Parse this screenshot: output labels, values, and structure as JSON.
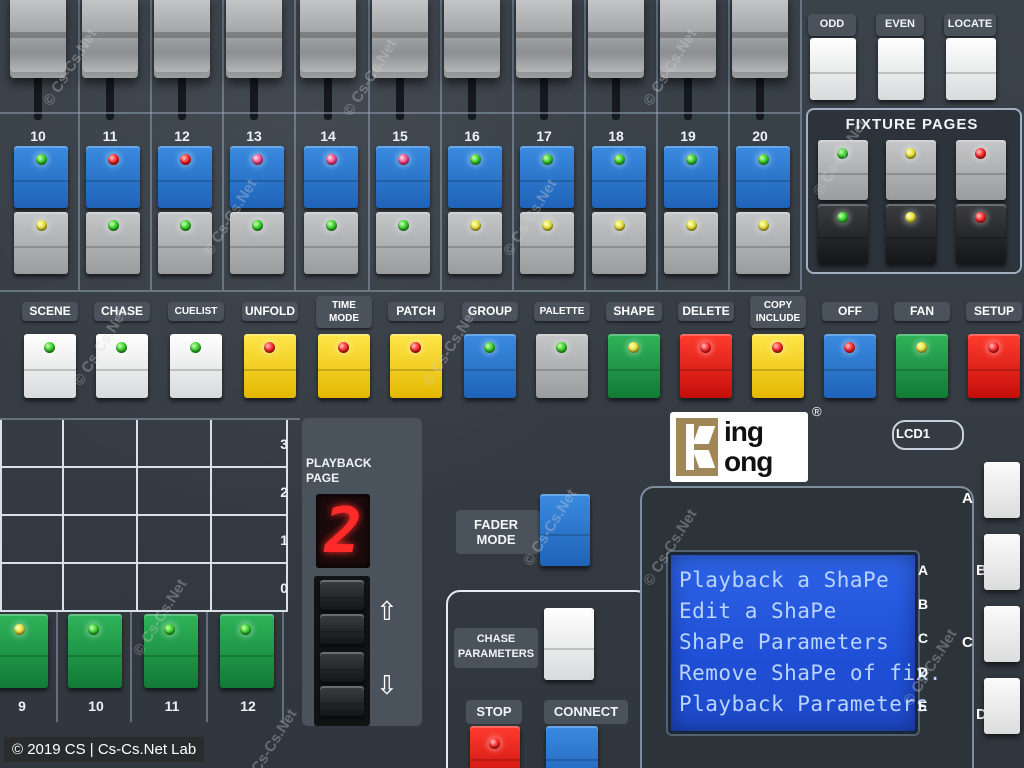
{
  "faders": {
    "numbers": [
      "10",
      "11",
      "12",
      "13",
      "14",
      "15",
      "16",
      "17",
      "18",
      "19",
      "20"
    ],
    "top_leds": [
      "green",
      "red",
      "red",
      "pink",
      "pink",
      "pink",
      "green",
      "green",
      "green",
      "green",
      "green"
    ],
    "bottom_leds": [
      "yellow",
      "green",
      "green",
      "green",
      "green",
      "green",
      "yellow",
      "yellow",
      "yellow",
      "yellow",
      "yellow"
    ]
  },
  "top_right": {
    "buttons": [
      "ODD",
      "EVEN",
      "LOCATE"
    ]
  },
  "fixture_pages": {
    "title": "FIXTURE PAGES",
    "top_leds": [
      "green",
      "yellow",
      "red"
    ],
    "bottom_leds": [
      "green",
      "yellow",
      "red"
    ]
  },
  "function_row": [
    {
      "label": "SCENE",
      "color": "white",
      "led": "green"
    },
    {
      "label": "CHASE",
      "color": "white",
      "led": "green"
    },
    {
      "label": "CUELIST",
      "color": "white",
      "led": "green"
    },
    {
      "label": "UNFOLD",
      "color": "yellow",
      "led": "red"
    },
    {
      "label": "TIME\nMODE",
      "color": "yellow",
      "led": "red"
    },
    {
      "label": "PATCH",
      "color": "yellow",
      "led": "red"
    },
    {
      "label": "GROUP",
      "color": "blue",
      "led": "green"
    },
    {
      "label": "PALETTE",
      "color": "grey",
      "led": "green"
    },
    {
      "label": "SHAPE",
      "color": "green",
      "led": "yellow"
    },
    {
      "label": "DELETE",
      "color": "red",
      "led": "red"
    },
    {
      "label": "COPY\nINCLUDE",
      "color": "yellow",
      "led": "red"
    },
    {
      "label": "OFF",
      "color": "blue",
      "led": "red"
    },
    {
      "label": "FAN",
      "color": "green",
      "led": "yellow"
    },
    {
      "label": "SETUP",
      "color": "red",
      "led": "red"
    }
  ],
  "playback_grid": {
    "row_numbers": [
      "3",
      "2",
      "1",
      "0"
    ],
    "bottom_numbers": [
      "9",
      "10",
      "11",
      "12"
    ],
    "button_leds": [
      "yellow",
      "green",
      "green",
      "green"
    ]
  },
  "playback_page": {
    "title": "PLAYBACK\nPAGE",
    "digit": "2",
    "up_arrow": "⇧",
    "down_arrow": "⇩"
  },
  "fader_mode": {
    "label": "FADER\nMODE"
  },
  "chase_parameters": {
    "label": "CHASE\nPARAMETERS"
  },
  "stop": {
    "label": "STOP"
  },
  "connect": {
    "label": "CONNECT"
  },
  "brand": {
    "line1": "ing",
    "line2": "ong",
    "registered": "®"
  },
  "lcd": {
    "label": "LCD1",
    "lines": [
      "Playback a ShaPe",
      "Edit a ShaPe",
      "ShaPe Parameters",
      "Remove ShaPe of fix.",
      "Playback Parameters"
    ],
    "side_labels": [
      "A",
      "B",
      "C",
      "D",
      "E"
    ],
    "outer_labels": [
      "A",
      "B",
      "C",
      "D"
    ]
  },
  "watermark": "© Cs-Cs.Net",
  "caption": "© 2019 CS | Cs-Cs.Net Lab",
  "colors": {
    "panel": "#353c44",
    "lcd_blue": "#1f4fd6",
    "seg_red": "#ff2a2a"
  }
}
